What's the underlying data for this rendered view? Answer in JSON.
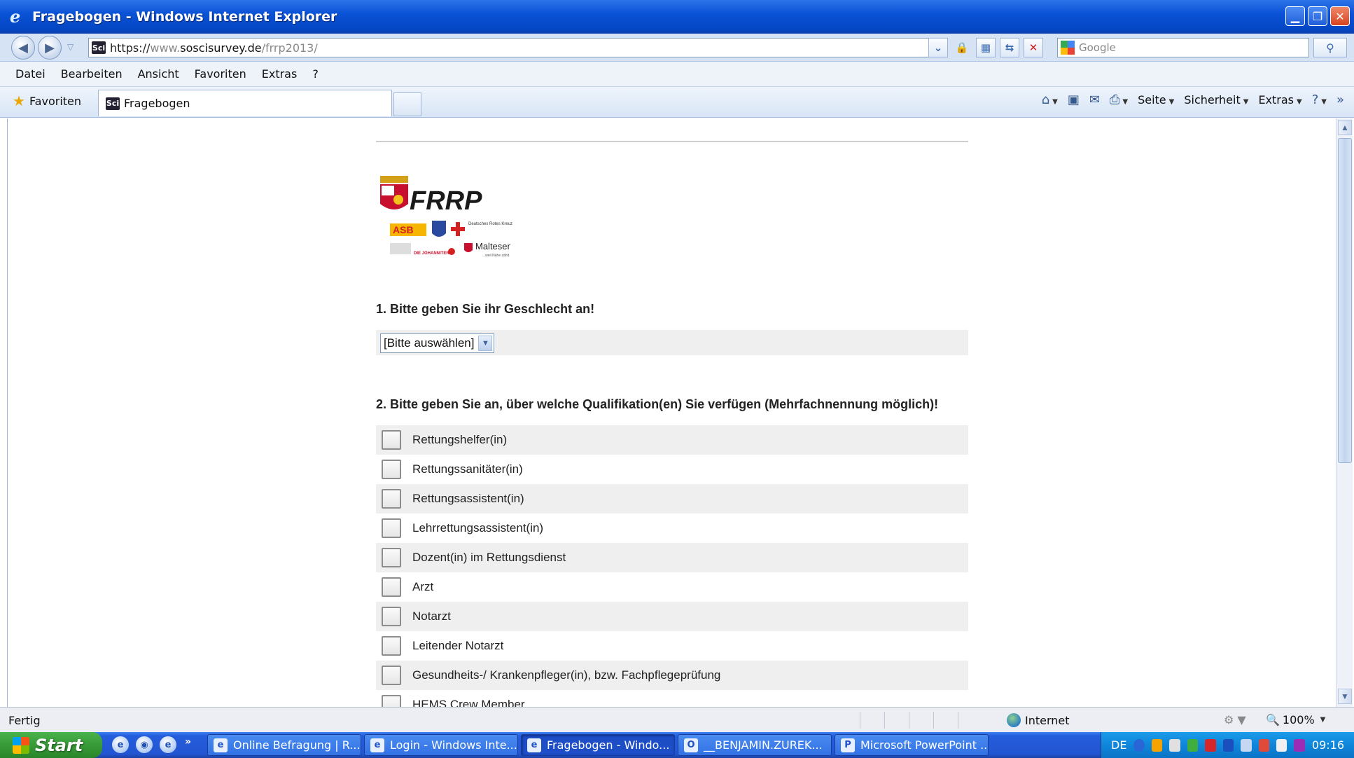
{
  "window": {
    "title": "Fragebogen - Windows Internet Explorer",
    "controls": {
      "minimize": "minimize",
      "restore": "restore",
      "close": "close"
    }
  },
  "address": {
    "scheme": "https://",
    "subdomain": "www.",
    "host": "soscisurvey.de",
    "path": "/frrp2013/",
    "favicon_text": "Sci",
    "search_placeholder": "Google"
  },
  "menu": [
    "Datei",
    "Bearbeiten",
    "Ansicht",
    "Favoriten",
    "Extras",
    "?"
  ],
  "favorites": {
    "label": "Favoriten"
  },
  "tab": {
    "label": "Fragebogen",
    "favicon_text": "Sci"
  },
  "command_bar": {
    "page": "Seite",
    "security": "Sicherheit",
    "extras": "Extras"
  },
  "survey": {
    "q1": {
      "title": "1. Bitte geben Sie ihr Geschlecht an!",
      "select_value": "[Bitte auswählen]"
    },
    "q2": {
      "title": "2. Bitte geben Sie an, über welche Qualifikation(en) Sie verfügen (Mehrfachnennung möglich)!",
      "options": [
        "Rettungshelfer(in)",
        "Rettungssanitäter(in)",
        "Rettungsassistent(in)",
        "Lehrrettungsassistent(in)",
        "Dozent(in) im Rettungsdienst",
        "Arzt",
        "Notarzt",
        "Leitender Notarzt",
        "Gesundheits-/ Krankenpfleger(in), bzw. Fachpflegeprüfung",
        "HEMS Crew Member"
      ]
    },
    "logo": {
      "main": "FRRP",
      "asb": "ASB",
      "drk": "Deutsches Rotes Kreuz",
      "johanniter": "DIE JOHANNITER",
      "malteser": "Malteser",
      "malteser_tagline": "...weil Nähe zählt."
    }
  },
  "status": {
    "text": "Fertig",
    "zone": "Internet",
    "zoom": "100%"
  },
  "taskbar": {
    "start": "Start",
    "tasks": [
      "Online Befragung | R...",
      "Login - Windows Inte...",
      "Fragebogen - Windo...",
      "__BENJAMIN.ZUREK...",
      "Microsoft PowerPoint ..."
    ],
    "language": "DE",
    "clock": "09:16"
  },
  "colors": {
    "titlebar": "#0a52d6",
    "taskbar": "#245ddb",
    "start": "#379b37",
    "row_stripe": "#efefef"
  }
}
